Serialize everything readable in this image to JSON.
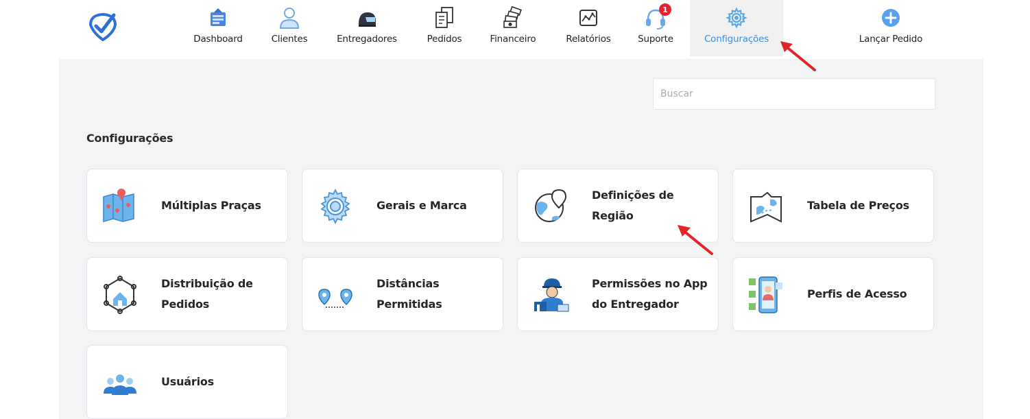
{
  "nav": {
    "items": [
      {
        "label": "Dashboard",
        "icon": "dashboard-icon"
      },
      {
        "label": "Clientes",
        "icon": "user-icon"
      },
      {
        "label": "Entregadores",
        "icon": "helmet-icon"
      },
      {
        "label": "Pedidos",
        "icon": "receipt-icon"
      },
      {
        "label": "Financeiro",
        "icon": "money-icon"
      },
      {
        "label": "Relatórios",
        "icon": "report-icon"
      },
      {
        "label": "Suporte",
        "icon": "headset-icon",
        "badge": "1"
      },
      {
        "label": "Configurações",
        "icon": "gear-icon",
        "active": true
      },
      {
        "label": "Lançar Pedido",
        "icon": "plus-circle-icon"
      }
    ]
  },
  "search": {
    "placeholder": "Buscar",
    "value": ""
  },
  "section": {
    "title": "Configurações"
  },
  "cards": [
    {
      "line1": "Múltiplas Praças",
      "line2": "",
      "icon": "map-icon"
    },
    {
      "line1": "Gerais e Marca",
      "line2": "",
      "icon": "gear-icon"
    },
    {
      "line1": "Definições de",
      "line2": "Região",
      "icon": "globe-pin-icon"
    },
    {
      "line1": "Tabela de Preços",
      "line2": "",
      "icon": "price-map-icon"
    },
    {
      "line1": "Distribuição de",
      "line2": "Pedidos",
      "icon": "network-icon"
    },
    {
      "line1": "Distâncias",
      "line2": "Permitidas",
      "icon": "route-pins-icon"
    },
    {
      "line1": "Permissões no App",
      "line2": "do Entregador",
      "icon": "courier-icon"
    },
    {
      "line1": "Perfis de Acesso",
      "line2": "",
      "icon": "profile-phone-icon"
    },
    {
      "line1": "Usuários",
      "line2": "",
      "icon": "users-icon"
    }
  ],
  "colors": {
    "accent": "#3a8ee0",
    "icon_blue": "#5aa8e6",
    "badge_red": "#e8212f",
    "arrow_red": "#e3252b",
    "page_bg": "#f3f4f6"
  }
}
